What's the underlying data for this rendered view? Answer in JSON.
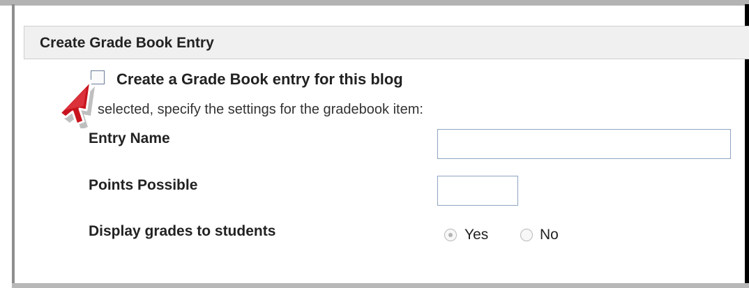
{
  "section": {
    "title": "Create Grade Book Entry"
  },
  "gradebook": {
    "checkbox_label": "Create a Grade Book entry for this blog",
    "checkbox_checked": false,
    "hint": "selected, specify the settings for the gradebook item:",
    "entry_name_label": "Entry Name",
    "entry_name_value": "",
    "points_label": "Points Possible",
    "points_value": "",
    "display_label": "Display grades to students",
    "option_yes": "Yes",
    "option_no": "No",
    "selected_option": "Yes"
  },
  "cursor": {
    "icon": "mouse-pointer-icon",
    "color": "#c8141e"
  }
}
